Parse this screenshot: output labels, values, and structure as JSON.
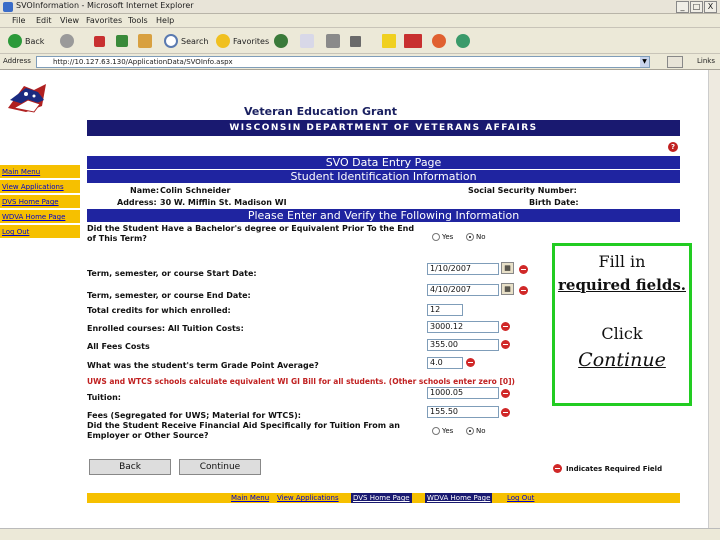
{
  "browser": {
    "title": "SVOInformation - Microsoft Internet Explorer",
    "window_buttons": [
      "_",
      "□",
      "X"
    ],
    "menu": [
      "File",
      "Edit",
      "View",
      "Favorites",
      "Tools",
      "Help"
    ],
    "toolbar": {
      "back": "Back",
      "search": "Search",
      "favorites": "Favorites"
    },
    "address_label": "Address",
    "address_value": "http://10.127.63.130/ApplicationData/SVOInfo.aspx",
    "links_label": "Links"
  },
  "page": {
    "grant_title": "Veteran Education Grant",
    "dept_banner": "WISCONSIN DEPARTMENT OF VETERANS AFFAIRS",
    "help": "?",
    "svo_header": "SVO Data Entry Page",
    "student_header": "Student Identification Information",
    "verify_header": "Please Enter and Verify the Following Information",
    "name_label": "Name:",
    "name_value": "Colin Schneider",
    "address_label": "Address:",
    "address_value": "30 W. Mifflin St. Madison WI",
    "ssn_label": "Social Security Number:",
    "birth_label": "Birth Date:"
  },
  "leftnav": [
    "Main Menu",
    "View Applications",
    "DVS Home Page",
    "WDVA Home Page",
    "Log Out"
  ],
  "form": {
    "q_bachelor": "Did the Student Have a Bachelor's degree or Equivalent Prior To the End of This Term?",
    "yes": "Yes",
    "no": "No",
    "start_label": "Term, semester, or course Start Date:",
    "start_value": "1/10/2007",
    "end_label": "Term, semester, or course End Date:",
    "end_value": "4/10/2007",
    "credits_label": "Total credits for which enrolled:",
    "credits_value": "12",
    "enrolled_label": "Enrolled courses: All Tuition Costs:",
    "enrolled_value": "3000.12",
    "fees_label": "All Fees Costs",
    "fees_value": "355.00",
    "gpa_label": "What was the student's term Grade Point Average?",
    "gpa_value": "4.0",
    "red_note": "UWS and WTCS schools calculate equivalent WI GI Bill for all students. (Other schools enter zero [0])",
    "tuition_label": "Tuition:",
    "tuition_value": "1000.05",
    "fees_seg_label": "Fees (Segregated for UWS; Material for WTCS):",
    "fees_seg_value": "155.50",
    "q_aid": "Did the Student Receive Financial Aid Specifically for Tuition From an Employer or Other Source?",
    "back_button": "Back",
    "continue_button": "Continue",
    "legend": "Indicates Required Field"
  },
  "bottomnav": [
    "Main Menu",
    "View Applications",
    "DVS Home Page",
    "WDVA Home Page",
    "Log Out"
  ],
  "callout": {
    "line1": "Fill in",
    "line2": "required fields.",
    "line3": "Click",
    "line4": "Continue"
  }
}
